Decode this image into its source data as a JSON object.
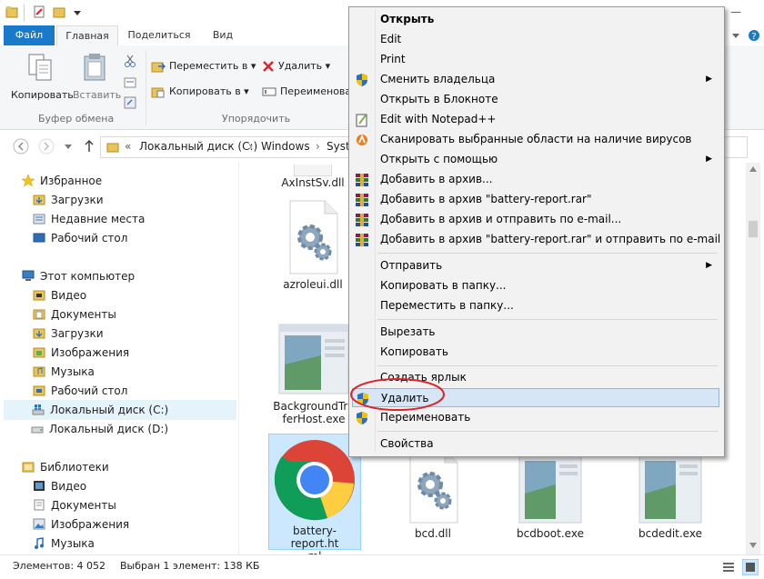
{
  "ribbon": {
    "tabs": [
      "Файл",
      "Главная",
      "Поделиться",
      "Вид"
    ],
    "copy_label": "Копировать",
    "paste_label": "Вставить",
    "clipboard_group": "Буфер обмена",
    "move_to": "Переместить в ▾",
    "copy_to": "Копировать в ▾",
    "delete": "Удалить ▾",
    "rename": "Переименовать",
    "organize_group": "Упорядочить"
  },
  "address": {
    "prefix": "«",
    "crumbs": [
      "Локальный диск (C:)",
      "Windows",
      "Syste"
    ],
    "sep": "›"
  },
  "nav": {
    "favorites": "Избранное",
    "fav_items": [
      "Загрузки",
      "Недавние места",
      "Рабочий стол"
    ],
    "computer": "Этот компьютер",
    "pc_items": [
      "Видео",
      "Документы",
      "Загрузки",
      "Изображения",
      "Музыка",
      "Рабочий стол",
      "Локальный диск (C:)",
      "Локальный диск (D:)"
    ],
    "libraries": "Библиотеки",
    "lib_items": [
      "Видео",
      "Документы",
      "Изображения",
      "Музыка"
    ]
  },
  "files": {
    "axinst": "AxInstSv.dll",
    "azroleui": "azroleui.dll",
    "bgtransfer_l1": "BackgroundTra",
    "bgtransfer_l2": "ferHost.exe",
    "battery_l1": "battery-report.ht",
    "battery_l2": "ml",
    "bcd": "bcd.dll",
    "bcdboot": "bcdboot.exe",
    "bcdedit": "bcdedit.exe"
  },
  "status": {
    "count": "Элементов: 4 052",
    "selected": "Выбран 1 элемент: 138 КБ"
  },
  "menu": {
    "open": "Открыть",
    "edit": "Edit",
    "print": "Print",
    "take_owner": "Сменить владельца",
    "open_notepad": "Открыть в Блокноте",
    "notepadpp": "Edit with Notepad++",
    "scan": "Сканировать выбранные области на наличие вирусов",
    "open_with": "Открыть с помощью",
    "add_archive": "Добавить в архив...",
    "add_rar": "Добавить в архив \"battery-report.rar\"",
    "add_email": "Добавить в архив и отправить по e-mail...",
    "add_rar_email": "Добавить в архив \"battery-report.rar\" и отправить по e-mail",
    "send_to": "Отправить",
    "copy_to_folder": "Копировать в папку...",
    "move_to_folder": "Переместить в папку...",
    "cut": "Вырезать",
    "copy": "Копировать",
    "create_shortcut": "Создать ярлык",
    "delete": "Удалить",
    "rename": "Переименовать",
    "properties": "Свойства",
    "arrow": "▶"
  },
  "colors": {
    "accent": "#1979ca",
    "selection": "#cce8ff",
    "highlight_circle": "#d9262c"
  }
}
